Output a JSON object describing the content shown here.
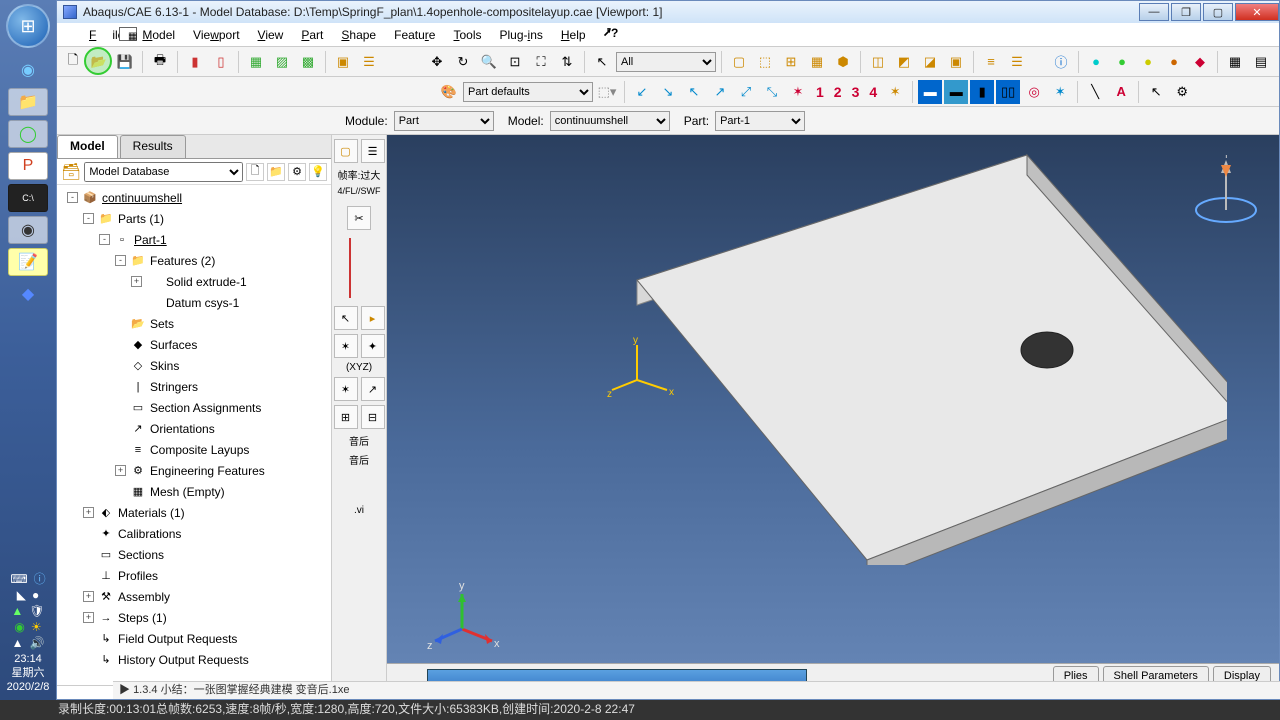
{
  "title": "Abaqus/CAE 6.13-1 - Model Database: D:\\Temp\\SpringF_plan\\1.4openhole-compositelayup.cae [Viewport: 1]",
  "menus": [
    "File",
    "Model",
    "Viewport",
    "View",
    "Part",
    "Shape",
    "Feature",
    "Tools",
    "Plug-ins",
    "Help"
  ],
  "partdefaults": "Part defaults",
  "datum_numbers": [
    "1",
    "2",
    "3",
    "4"
  ],
  "context": {
    "module_label": "Module:",
    "module": "Part",
    "model_label": "Model:",
    "model": "continuumshell",
    "part_label": "Part:",
    "part": "Part-1"
  },
  "tabs": {
    "model": "Model",
    "results": "Results"
  },
  "db_selector": "Model Database",
  "tree": [
    {
      "ind": 0,
      "exp": "-",
      "ico": "📦",
      "lbl": "continuumshell",
      "u": true
    },
    {
      "ind": 1,
      "exp": "-",
      "ico": "📁",
      "lbl": "Parts (1)"
    },
    {
      "ind": 2,
      "exp": "-",
      "ico": "▫",
      "lbl": "Part-1",
      "u": true
    },
    {
      "ind": 3,
      "exp": "-",
      "ico": "📁",
      "lbl": "Features (2)"
    },
    {
      "ind": 4,
      "exp": "+",
      "ico": "",
      "lbl": "Solid extrude-1"
    },
    {
      "ind": 4,
      "exp": "",
      "ico": "",
      "lbl": "Datum csys-1"
    },
    {
      "ind": 3,
      "exp": "",
      "ico": "📂",
      "lbl": "Sets"
    },
    {
      "ind": 3,
      "exp": "",
      "ico": "◆",
      "lbl": "Surfaces"
    },
    {
      "ind": 3,
      "exp": "",
      "ico": "◇",
      "lbl": "Skins"
    },
    {
      "ind": 3,
      "exp": "",
      "ico": "|",
      "lbl": "Stringers"
    },
    {
      "ind": 3,
      "exp": "",
      "ico": "▭",
      "lbl": "Section Assignments"
    },
    {
      "ind": 3,
      "exp": "",
      "ico": "↗",
      "lbl": "Orientations"
    },
    {
      "ind": 3,
      "exp": "",
      "ico": "≡",
      "lbl": "Composite Layups"
    },
    {
      "ind": 3,
      "exp": "+",
      "ico": "⚙",
      "lbl": "Engineering Features"
    },
    {
      "ind": 3,
      "exp": "",
      "ico": "▦",
      "lbl": "Mesh (Empty)"
    },
    {
      "ind": 1,
      "exp": "+",
      "ico": "⬖",
      "lbl": "Materials (1)"
    },
    {
      "ind": 1,
      "exp": "",
      "ico": "✦",
      "lbl": "Calibrations"
    },
    {
      "ind": 1,
      "exp": "",
      "ico": "▭",
      "lbl": "Sections"
    },
    {
      "ind": 1,
      "exp": "",
      "ico": "⊥",
      "lbl": "Profiles"
    },
    {
      "ind": 1,
      "exp": "+",
      "ico": "⚒",
      "lbl": "Assembly"
    },
    {
      "ind": 1,
      "exp": "+",
      "ico": "→",
      "lbl": "Steps (1)"
    },
    {
      "ind": 1,
      "exp": "",
      "ico": "↳",
      "lbl": "Field Output Requests"
    },
    {
      "ind": 1,
      "exp": "",
      "ico": "↳",
      "lbl": "History Output Requests"
    }
  ],
  "midstrip_text": [
    "帧率:过大",
    "4/FL//SWF",
    "(XYZ)",
    "音后",
    "音后",
    ".vi"
  ],
  "axes": {
    "x": "x",
    "y": "y",
    "z": "z",
    "Y": "Y"
  },
  "bottom_tabs": [
    "Plies",
    "Shell Parameters",
    "Display"
  ],
  "footer_left": "1.3.4  小结：一张图掌握经典建模  变音后.1xe",
  "status": "录制长度:00:13:01总帧数:6253,速度:8帧/秒,宽度:1280,高度:720,文件大小:65383KB,创建时间:2020-2-8 22:47",
  "clock": {
    "time": "23:14",
    "dow": "星期六",
    "date": "2020/2/8"
  },
  "select_all": "All"
}
